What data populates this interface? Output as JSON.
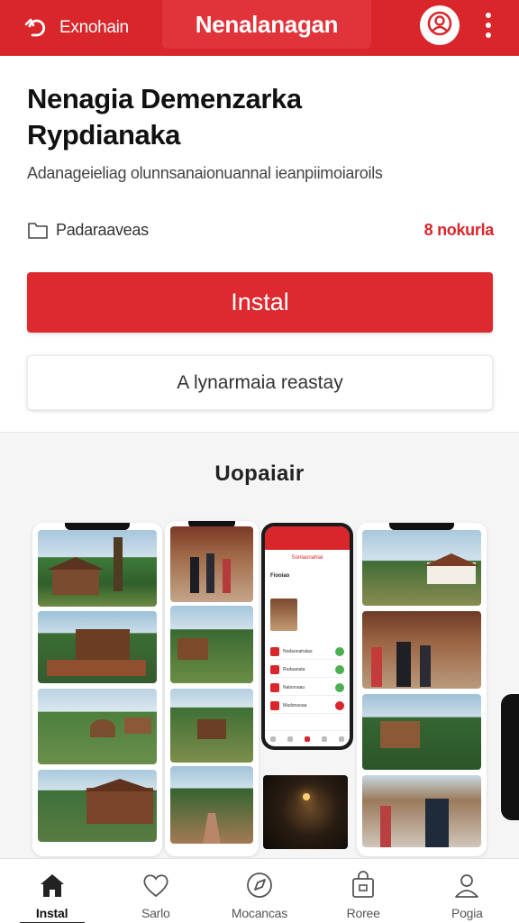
{
  "header": {
    "back_label": "Exnohain",
    "title": "Nenalanagan",
    "colors": {
      "brand": "#d9262b",
      "white": "#ffffff"
    },
    "icons": {
      "back": "return-arrow-icon",
      "profile": "user-icon",
      "more": "vertical-dots-icon"
    }
  },
  "app": {
    "title_line1": "Nenagia Demenzarka",
    "title_line2": "Rypdianaka",
    "description": "Adanageieliag olunnsanaionuannal ieanpiimoiaroils",
    "category": "Padaraaveas",
    "count": "8 nokurla",
    "install_label": "Instal",
    "secondary_label": "A lynarmaia reastay"
  },
  "gallery": {
    "title": "Uopaiair",
    "phone_screen": {
      "title": "Sonlaonahiai",
      "heading": "Fiooiao",
      "items": [
        "Nodaonahalao",
        "Rodaanata",
        "Naloonaau",
        "Madonaoaa"
      ]
    }
  },
  "bottom_nav": {
    "items": [
      {
        "label": "Instal",
        "icon": "home-icon",
        "active": true
      },
      {
        "label": "Sarlo",
        "icon": "heart-icon",
        "active": false
      },
      {
        "label": "Mocancas",
        "icon": "compass-icon",
        "active": false
      },
      {
        "label": "Roree",
        "icon": "bag-icon",
        "active": false
      },
      {
        "label": "Pogia",
        "icon": "person-icon",
        "active": false
      }
    ]
  }
}
